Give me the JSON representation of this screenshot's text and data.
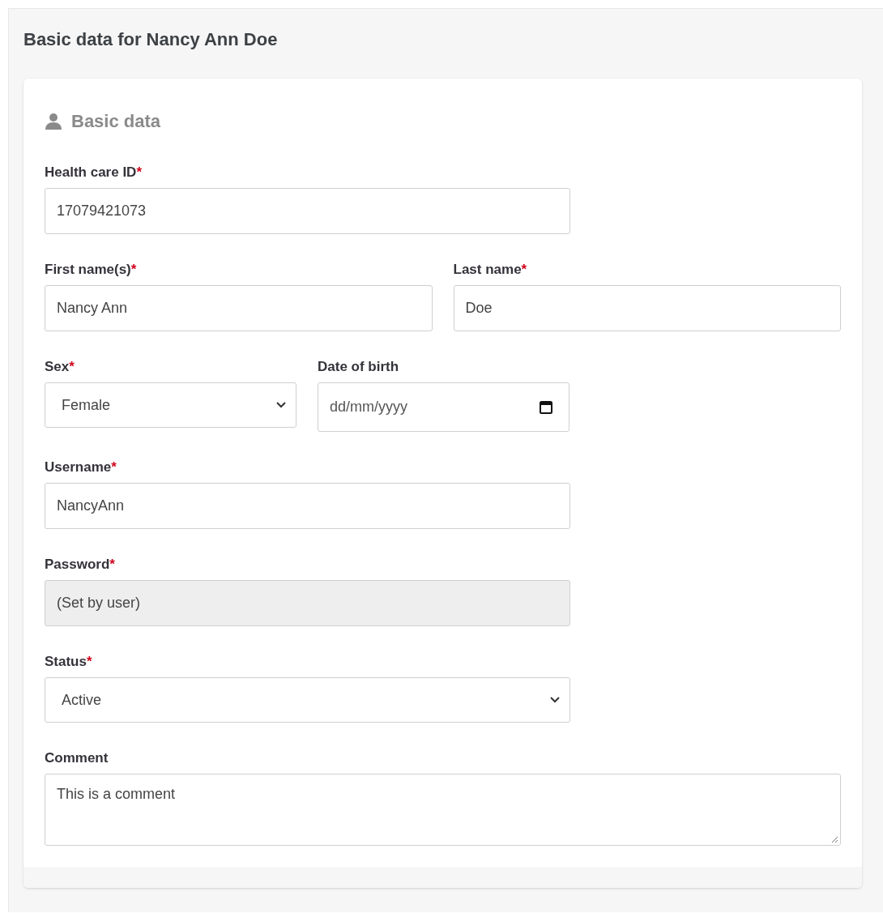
{
  "page_title": "Basic data for Nancy Ann Doe",
  "section": {
    "title": "Basic data"
  },
  "rows": [
    [
      {
        "kind": "text",
        "label": "Health care ID",
        "mark": "*",
        "value": "17079421073",
        "disabled": false
      }
    ],
    [
      {
        "kind": "text",
        "label": "First name(s)",
        "mark": "*",
        "value": "Nancy Ann",
        "disabled": false
      },
      {
        "kind": "text",
        "label": "Last name",
        "mark": "*",
        "value": "Doe",
        "disabled": false
      }
    ],
    [
      {
        "kind": "select",
        "label": "Sex",
        "mark": "*",
        "value": "Female",
        "disabled": false
      },
      {
        "kind": "date",
        "label": "Date of birth",
        "placeholder": "dd/mm/yyyy",
        "disabled": false
      }
    ],
    [
      {
        "kind": "text",
        "label": "Username",
        "mark": "*",
        "value": "NancyAnn",
        "disabled": false
      }
    ],
    [
      {
        "kind": "text",
        "label": "Password",
        "mark": "*",
        "value": "(Set by user)",
        "disabled": true
      }
    ],
    [
      {
        "kind": "select",
        "label": "Status",
        "mark": "*",
        "value": "Active",
        "disabled": false
      }
    ],
    [
      {
        "kind": "textarea",
        "label": "Comment",
        "value": "This is a comment",
        "disabled": false
      }
    ]
  ]
}
